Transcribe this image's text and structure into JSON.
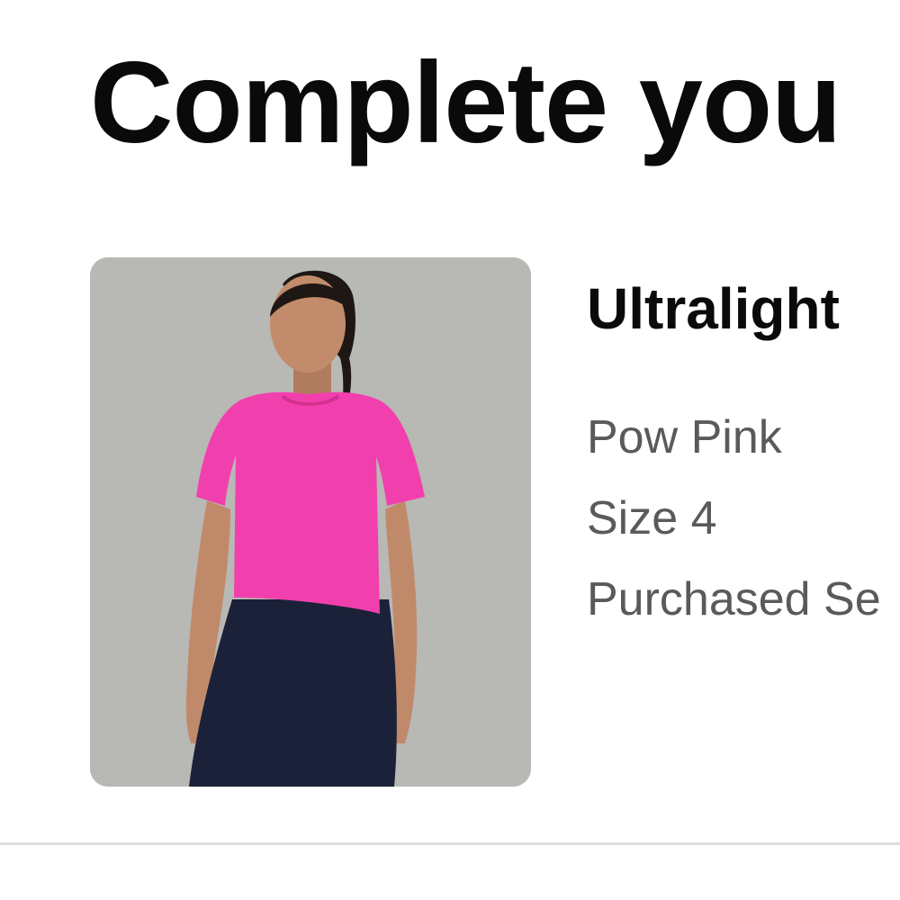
{
  "section": {
    "heading": "Complete you"
  },
  "product": {
    "title": "Ultralight",
    "color": "Pow Pink",
    "size": "Size 4",
    "purchased": "Purchased Se",
    "image_icon": "product-photo",
    "colors": {
      "shirt": "#f23fae",
      "background": "#b8b8b5"
    }
  }
}
